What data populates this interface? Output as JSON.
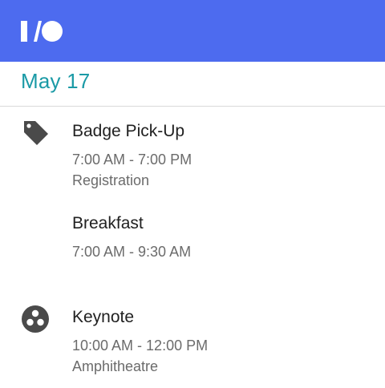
{
  "header": {
    "logo_icon": "io-logo-icon",
    "bar_color": "#4d6bef"
  },
  "date": {
    "label": "May 17"
  },
  "sessions": [
    {
      "icon": "tag-icon",
      "title": "Badge Pick-Up",
      "time": "7:00 AM - 7:00 PM",
      "room": "Registration"
    },
    {
      "icon": "",
      "title": "Breakfast",
      "time": "7:00 AM - 9:30 AM",
      "room": ""
    },
    {
      "icon": "keynote-circle-icon",
      "title": "Keynote",
      "time": "10:00 AM - 12:00 PM",
      "room": "Amphitheatre"
    }
  ]
}
